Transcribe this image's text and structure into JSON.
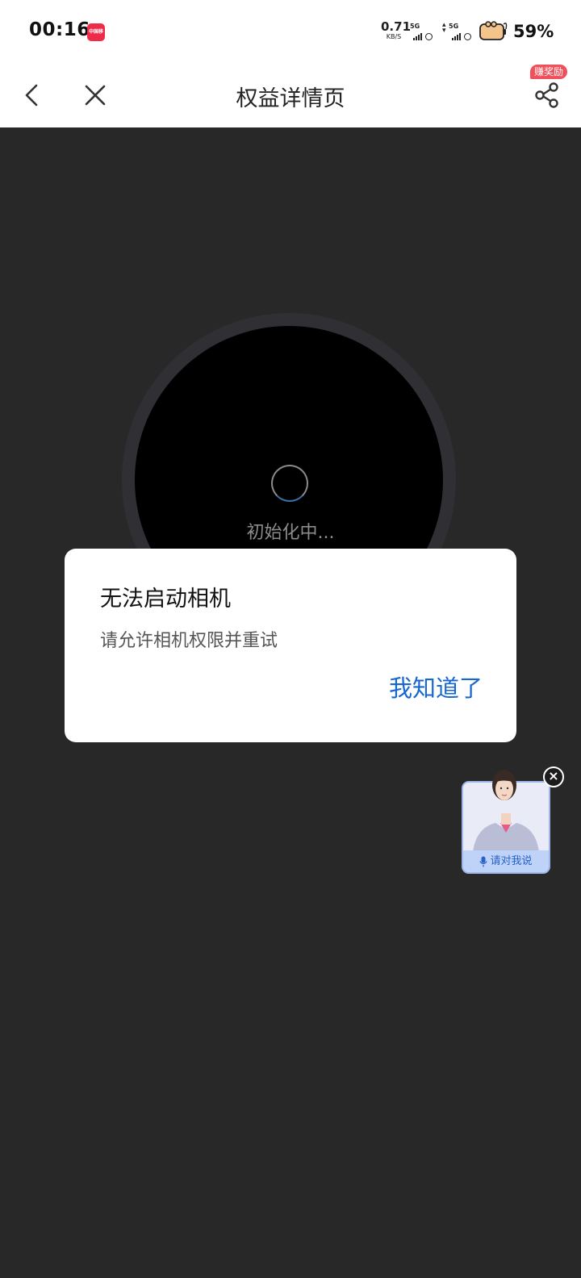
{
  "status_bar": {
    "time": "00:16",
    "app_icon_text": "中国移动",
    "net_speed_value": "0.71",
    "net_speed_unit": "KB/S",
    "sim1_type": "5G",
    "sim2_type": "5G",
    "battery_percent": "59%"
  },
  "nav": {
    "title": "权益详情页",
    "badge": "赚奖励"
  },
  "camera": {
    "status_text": "初始化中..."
  },
  "dialog": {
    "title": "无法启动相机",
    "message": "请允许相机权限并重试",
    "confirm_label": "我知道了"
  },
  "assistant": {
    "label": "请对我说",
    "close_symbol": "×"
  },
  "colors": {
    "background": "#282828",
    "dialog_button": "#1767d1",
    "badge": "#f0505a"
  }
}
